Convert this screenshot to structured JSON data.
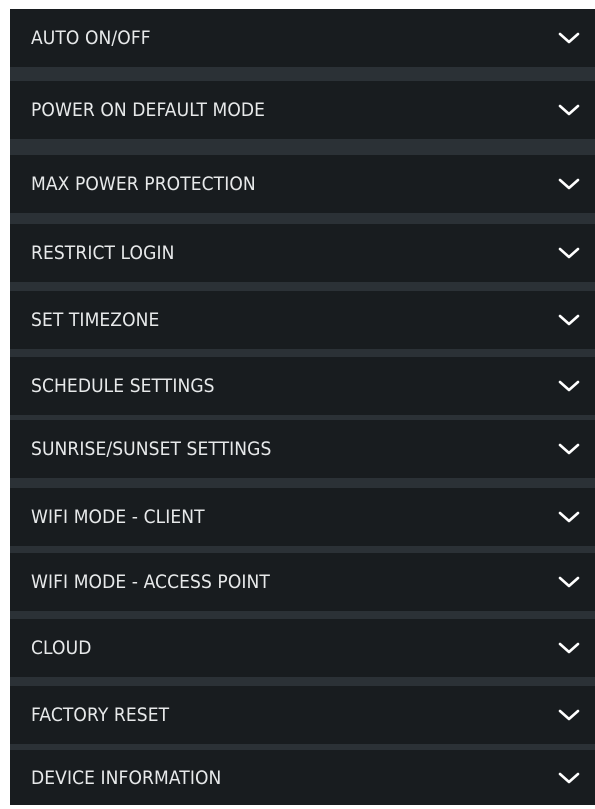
{
  "menu": {
    "items": [
      {
        "label": "AUTO ON/OFF",
        "icon": "chevron-down-icon"
      },
      {
        "label": "POWER ON DEFAULT MODE",
        "icon": "chevron-down-icon"
      },
      {
        "label": "MAX POWER PROTECTION",
        "icon": "chevron-down-icon"
      },
      {
        "label": "RESTRICT LOGIN",
        "icon": "chevron-down-icon"
      },
      {
        "label": "SET TIMEZONE",
        "icon": "chevron-down-icon"
      },
      {
        "label": "SCHEDULE SETTINGS",
        "icon": "chevron-down-icon"
      },
      {
        "label": "SUNRISE/SUNSET SETTINGS",
        "icon": "chevron-down-icon"
      },
      {
        "label": "WIFI MODE - CLIENT",
        "icon": "chevron-down-icon"
      },
      {
        "label": "WIFI MODE - ACCESS POINT",
        "icon": "chevron-down-icon"
      },
      {
        "label": "CLOUD",
        "icon": "chevron-down-icon"
      },
      {
        "label": "FACTORY RESET",
        "icon": "chevron-down-icon"
      },
      {
        "label": "DEVICE INFORMATION",
        "icon": "chevron-down-icon"
      }
    ]
  },
  "colors": {
    "page_background": "#ffffff",
    "panel_background": "#2b3136",
    "item_background": "#181c1f",
    "text": "#e7e9ea",
    "chevron": "#ffffff"
  }
}
